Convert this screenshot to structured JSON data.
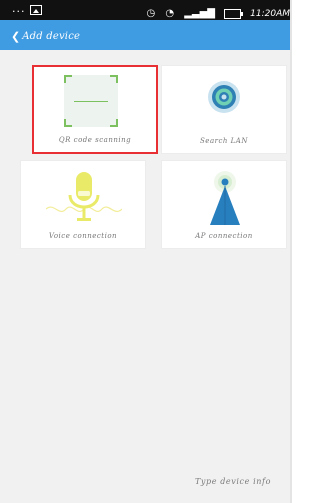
{
  "status_bar": {
    "left_indicator": "...",
    "time": "11:20AM"
  },
  "header": {
    "back_glyph": "❮",
    "title": "Add device"
  },
  "tiles": [
    {
      "label": "QR code scanning",
      "icon": "qr-scan-icon",
      "selected": true
    },
    {
      "label": "Search LAN",
      "icon": "lan-search-icon",
      "selected": false
    },
    {
      "label": "Voice connection",
      "icon": "microphone-icon",
      "selected": false
    },
    {
      "label": "AP connection",
      "icon": "access-point-icon",
      "selected": false
    }
  ],
  "footer": {
    "hint": "Type device info"
  },
  "colors": {
    "header": "#3f9be2",
    "selected_border": "#e72f34",
    "qr_green": "#7dc05f",
    "voice_yellow": "#eaea69",
    "ap_blue": "#277fbe"
  }
}
